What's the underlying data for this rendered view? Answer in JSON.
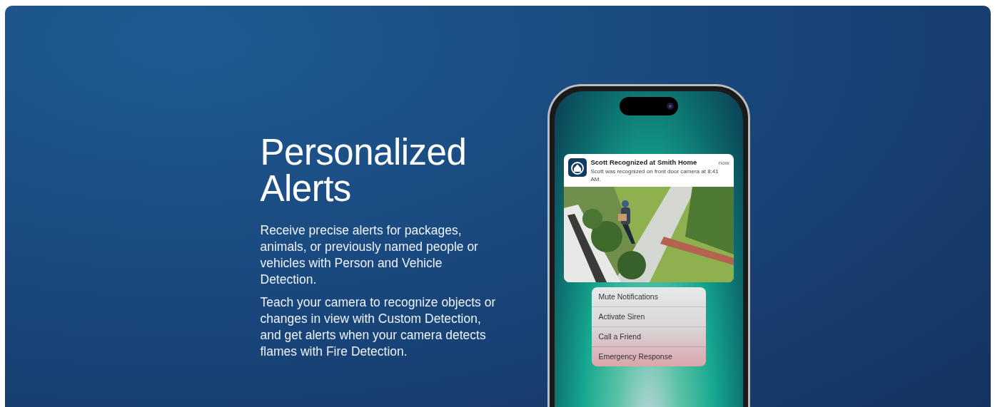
{
  "heading": "Personalized Alerts",
  "paragraphs": [
    "Receive precise alerts for packages, animals, or previously named people or vehicles with Person and Vehicle Detection.",
    "Teach your camera to recognize objects or changes in view with Custom Detection, and get alerts when your camera detects flames with Fire Detection."
  ],
  "notification": {
    "title": "Scott Recognized at Smith Home",
    "time": "now",
    "body": "Scott was recognized on front door camera at 8:41 AM."
  },
  "actions": [
    "Mute Notifications",
    "Activate Siren",
    "Call a Friend",
    "Emergency Response"
  ]
}
